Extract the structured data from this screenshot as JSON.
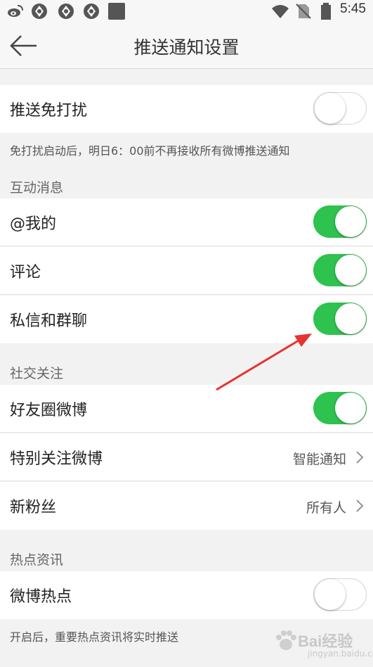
{
  "status_bar": {
    "time": "5:45"
  },
  "nav": {
    "title": "推送通知设置"
  },
  "dnd": {
    "label": "推送免打扰",
    "enabled": false,
    "note": "免打扰启动后，明日6：00前不再接收所有微博推送通知"
  },
  "interaction": {
    "header": "互动消息",
    "items": [
      {
        "label": "@我的",
        "enabled": true
      },
      {
        "label": "评论",
        "enabled": true
      },
      {
        "label": "私信和群聊",
        "enabled": true
      }
    ]
  },
  "social": {
    "header": "社交关注",
    "friends_circle": {
      "label": "好友圈微博",
      "enabled": true
    },
    "special_follow": {
      "label": "特别关注微博",
      "value": "智能通知"
    },
    "new_fans": {
      "label": "新粉丝",
      "value": "所有人"
    }
  },
  "hot": {
    "header": "热点资讯",
    "weibo_hot": {
      "label": "微博热点",
      "enabled": false
    },
    "note": "开启后，重要热点资讯将实时推送"
  },
  "watermark": {
    "text": "Bai经验",
    "sub": "jingyan.baidu.com"
  },
  "colors": {
    "toggle_on": "#2ec24e",
    "annotation_arrow": "#e8322f"
  }
}
